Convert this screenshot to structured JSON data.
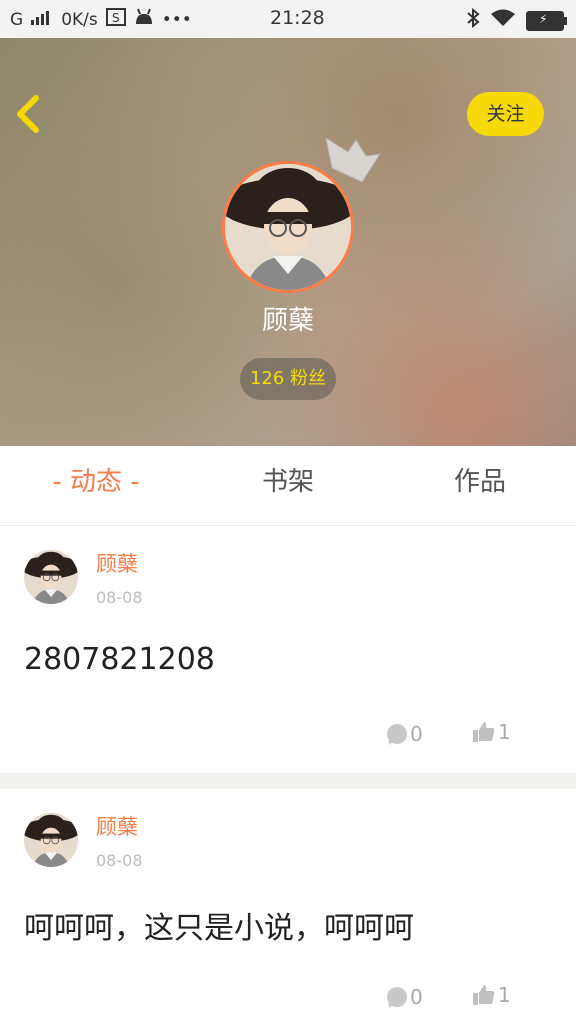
{
  "status_bar": {
    "network": "G",
    "speed": "0K/s",
    "time": "21:28"
  },
  "profile": {
    "follow_label": "关注",
    "username": "顾蘖",
    "fans_label": "126 粉丝"
  },
  "tabs": [
    {
      "label": "- 动态 -",
      "active": true
    },
    {
      "label": "书架",
      "active": false
    },
    {
      "label": "作品",
      "active": false
    }
  ],
  "posts": [
    {
      "author": "顾蘖",
      "date": "08-08",
      "content": "2807821208",
      "comments": "0",
      "likes": "1"
    },
    {
      "author": "顾蘖",
      "date": "08-08",
      "content": "呵呵呵，这只是小说，呵呵呵",
      "comments": "0",
      "likes": "1"
    }
  ],
  "colors": {
    "accent": "#f57d4a",
    "yellow": "#f7d90a"
  }
}
